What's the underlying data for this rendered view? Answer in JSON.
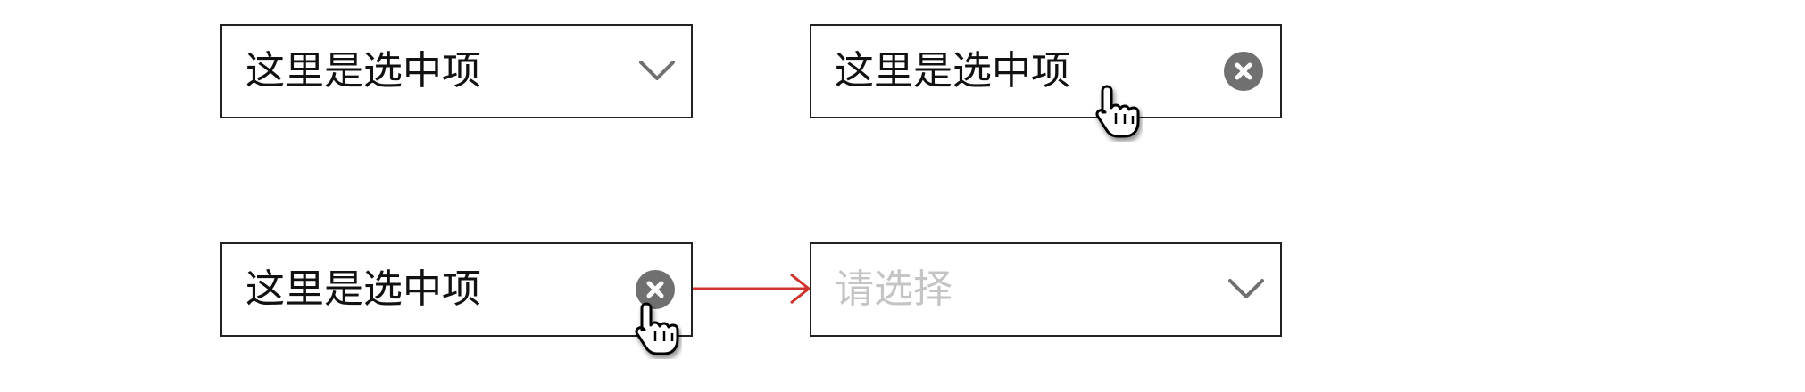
{
  "selects": [
    {
      "state": "default-with-value",
      "value": "这里是选中项",
      "icon": "chevron-down-icon"
    },
    {
      "state": "hover-with-clear",
      "value": "这里是选中项",
      "icon": "clear-icon"
    },
    {
      "state": "click-clear",
      "value": "这里是选中项",
      "icon": "clear-icon"
    },
    {
      "state": "cleared",
      "placeholder": "请选择",
      "icon": "chevron-down-icon"
    }
  ],
  "colors": {
    "border": "#222222",
    "text": "#111111",
    "placeholder": "#c4c4c4",
    "clear_icon": "#707070",
    "chevron": "#707070",
    "arrow": "#d0342c"
  }
}
